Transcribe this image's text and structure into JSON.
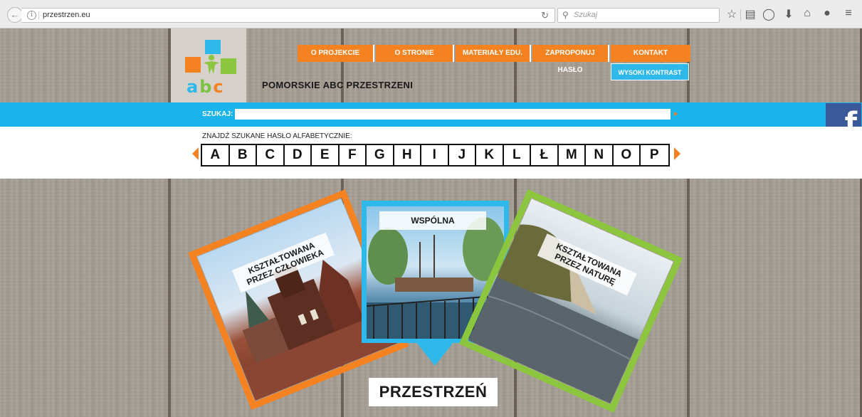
{
  "browser": {
    "url": "przestrzen.eu",
    "search_placeholder": "Szukaj"
  },
  "header": {
    "site_title": "POMORSKIE ABC PRZESTRZENI",
    "logo_text": {
      "a": "a",
      "b": "b",
      "c": "c"
    },
    "nav": [
      {
        "label": "O PROJEKCIE"
      },
      {
        "label": "O STRONIE"
      },
      {
        "label": "MATERIAŁY EDU."
      },
      {
        "label": "ZAPROPONUJ HASŁO"
      },
      {
        "label": "KONTAKT"
      }
    ],
    "contrast_label": "WYSOKI KONTRAST"
  },
  "search": {
    "label": "SZUKAJ:",
    "value": ""
  },
  "facebook": {
    "glyph": "f"
  },
  "alphabet": {
    "title": "ZNAJDŹ SZUKANE HASŁO ALFABETYCZNIE:",
    "letters": [
      "A",
      "B",
      "C",
      "D",
      "E",
      "F",
      "G",
      "H",
      "I",
      "J",
      "K",
      "L",
      "Ł",
      "M",
      "N",
      "O",
      "P"
    ]
  },
  "cards": [
    {
      "label_line1": "KSZTAŁTOWANA",
      "label_line2": "PRZEZ CZŁOWIEKA",
      "color": "#f58220"
    },
    {
      "label_line1": "WSPÓLNA",
      "color": "#2fb9ea"
    },
    {
      "label_line1": "KSZTAŁTOWANA",
      "label_line2": "PRZEZ NATURĘ",
      "color": "#8cc63f"
    }
  ],
  "main_title": "PRZESTRZEŃ",
  "colors": {
    "orange": "#f58220",
    "blue": "#2fb9ea",
    "green": "#8cc63f",
    "facebook": "#3b5998"
  }
}
